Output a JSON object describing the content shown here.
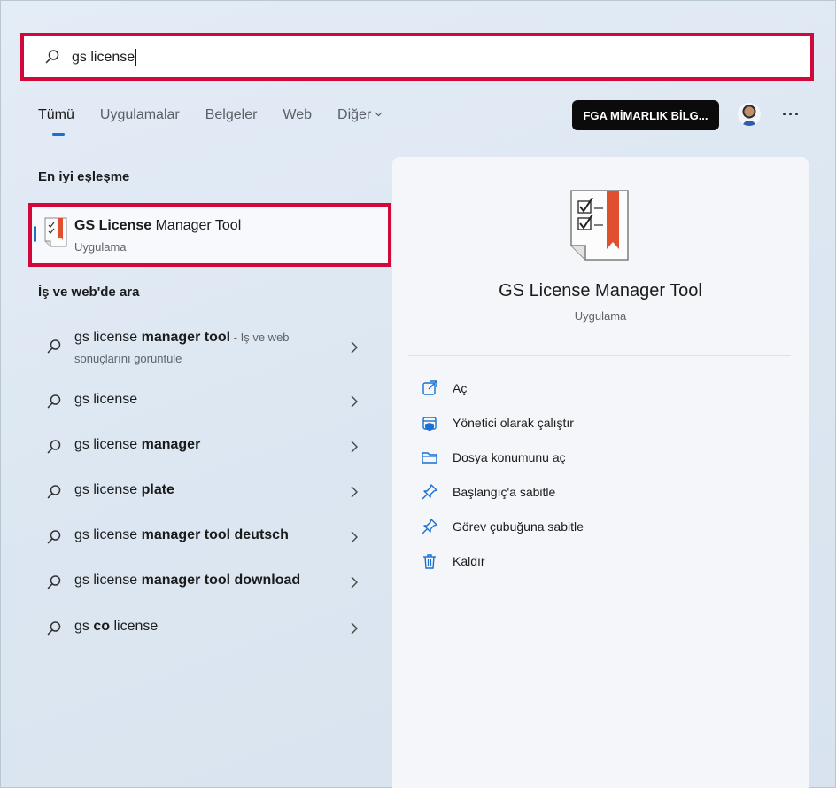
{
  "search": {
    "value": "gs license"
  },
  "tabs": [
    {
      "label": "Tümü"
    },
    {
      "label": "Uygulamalar"
    },
    {
      "label": "Belgeler"
    },
    {
      "label": "Web"
    },
    {
      "label": "Diğer"
    }
  ],
  "header": {
    "account_label": "FGA MİMARLIK BİLG...",
    "more_label": "···"
  },
  "best_match": {
    "section_title": "En iyi eşleşme",
    "name_bold": "GS License",
    "name_rest": " Manager Tool",
    "type": "Uygulama"
  },
  "web": {
    "section_title": "İş ve web'de ara",
    "items": [
      {
        "normal": "gs license ",
        "bold": "manager tool",
        "suffix": " - İş ve web sonuçlarını görüntüle"
      },
      {
        "normal": "gs license",
        "bold": "",
        "suffix": ""
      },
      {
        "normal": "gs license ",
        "bold": "manager",
        "suffix": ""
      },
      {
        "normal": "gs license ",
        "bold": "plate",
        "suffix": ""
      },
      {
        "normal": "gs license ",
        "bold": "manager tool deutsch",
        "suffix": ""
      },
      {
        "normal": "gs license ",
        "bold": "manager tool download",
        "suffix": ""
      },
      {
        "normal": "gs ",
        "bold": "co",
        "suffix": ""
      }
    ],
    "last_item_tail": " license"
  },
  "preview": {
    "title": "GS License Manager Tool",
    "subtitle": "Uygulama",
    "actions": [
      {
        "label": "Aç",
        "icon": "open-external-icon"
      },
      {
        "label": "Yönetici olarak çalıştır",
        "icon": "shield-admin-icon"
      },
      {
        "label": "Dosya konumunu aç",
        "icon": "folder-icon"
      },
      {
        "label": "Başlangıç'a sabitle",
        "icon": "pin-icon"
      },
      {
        "label": "Görev çubuğuna sabitle",
        "icon": "pin-icon"
      },
      {
        "label": "Kaldır",
        "icon": "trash-icon"
      }
    ]
  },
  "colors": {
    "highlight_border": "#d1093a",
    "accent": "#1a6fd1"
  }
}
